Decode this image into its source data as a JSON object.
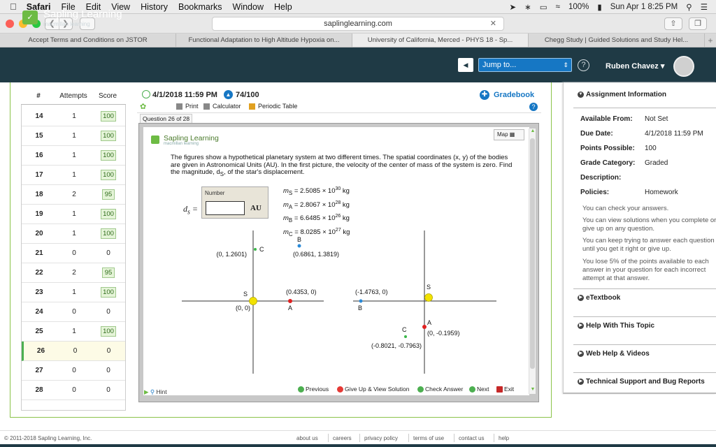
{
  "menubar": {
    "apple": "",
    "items": [
      "Safari",
      "File",
      "Edit",
      "View",
      "History",
      "Bookmarks",
      "Window",
      "Help"
    ],
    "battery": "100%",
    "datetime": "Sun Apr 1  8:25 PM"
  },
  "browser": {
    "url": "saplinglearning.com",
    "tabs": [
      "Accept Terms and Conditions on JSTOR",
      "Functional Adaptation to High Altitude Hypoxia on...",
      "University of California, Merced - PHYS 18 - Sp...",
      "Chegg Study | Guided Solutions and Study Hel..."
    ],
    "new_tab": "+"
  },
  "header": {
    "brand": "Sapling Learning",
    "sub": "macmillan learning",
    "jump": "Jump to...",
    "help": "?",
    "user": "Ruben Chavez ▾"
  },
  "attempts": {
    "headers": [
      "#",
      "Attempts",
      "Score"
    ],
    "rows": [
      {
        "q": "14",
        "a": "1",
        "s": "100",
        "boxed": true
      },
      {
        "q": "15",
        "a": "1",
        "s": "100",
        "boxed": true
      },
      {
        "q": "16",
        "a": "1",
        "s": "100",
        "boxed": true
      },
      {
        "q": "17",
        "a": "1",
        "s": "100",
        "boxed": true
      },
      {
        "q": "18",
        "a": "2",
        "s": "95",
        "boxed": true
      },
      {
        "q": "19",
        "a": "1",
        "s": "100",
        "boxed": true
      },
      {
        "q": "20",
        "a": "1",
        "s": "100",
        "boxed": true
      },
      {
        "q": "21",
        "a": "0",
        "s": "0",
        "boxed": false
      },
      {
        "q": "22",
        "a": "2",
        "s": "95",
        "boxed": true
      },
      {
        "q": "23",
        "a": "1",
        "s": "100",
        "boxed": true
      },
      {
        "q": "24",
        "a": "0",
        "s": "0",
        "boxed": false
      },
      {
        "q": "25",
        "a": "1",
        "s": "100",
        "boxed": true
      },
      {
        "q": "26",
        "a": "0",
        "s": "0",
        "boxed": false,
        "current": true
      },
      {
        "q": "27",
        "a": "0",
        "s": "0",
        "boxed": false
      },
      {
        "q": "28",
        "a": "0",
        "s": "0",
        "boxed": false
      }
    ]
  },
  "question": {
    "due": "4/1/2018 11:59 PM",
    "points": "74/100",
    "gradebook": "Gradebook",
    "tools": [
      "Print",
      "Calculator",
      "Periodic Table"
    ],
    "label": "Question 26 of 28",
    "brand": "Sapling Learning",
    "brand_sub": "macmillan learning",
    "map": "Map",
    "text": "The figures show a hypothetical planetary system at two different times. The spatial coordinates (x, y) of the bodies are given in Astronomical Units (AU). In the first picture, the velocity of the center of mass of the system is zero. Find the magnitude, d",
    "text_sub": "S",
    "text_end": ", of the star's displacement.",
    "answer_label": "Number",
    "answer_value": "",
    "answer_unit": "AU",
    "ds": "d",
    "ds_sub": "s",
    "ds_eq": " =",
    "masses": [
      {
        "sym": "m",
        "sub": "S",
        "val": " = 2.5085 × 10",
        "exp": "30",
        "unit": " kg"
      },
      {
        "sym": "m",
        "sub": "A",
        "val": " = 2.8067 × 10",
        "exp": "28",
        "unit": " kg"
      },
      {
        "sym": "m",
        "sub": "B",
        "val": " = 6.6485 × 10",
        "exp": "26",
        "unit": " kg"
      },
      {
        "sym": "m",
        "sub": "C",
        "val": " = 8.0285 × 10",
        "exp": "27",
        "unit": " kg"
      }
    ],
    "diagram": {
      "left": {
        "C": {
          "label": "C",
          "coord": "(0, 1.2601)"
        },
        "B": {
          "label": "B",
          "coord": "(0.6861, 1.3819)"
        },
        "S": {
          "label": "S",
          "coord": "(0, 0)"
        },
        "A": {
          "label": "A",
          "coord": "(0.4353, 0)"
        }
      },
      "right": {
        "S": {
          "label": "S"
        },
        "B": {
          "label": "B",
          "coord": "(-1.4763, 0)"
        },
        "A": {
          "label": "A",
          "coord": "(0, -0.1959)"
        },
        "C": {
          "label": "C",
          "coord": "(-0.8021, -0.7963)"
        }
      },
      "colors": {
        "star": "#f2e200",
        "A": "#e02020",
        "B": "#2a8ad8",
        "C": "#3ab84a"
      }
    },
    "hint": "Hint",
    "previous": "Previous",
    "giveup": "Give Up & View Solution",
    "check": "Check Answer",
    "next": "Next",
    "exit": "Exit"
  },
  "panel": {
    "assignment_info": "Assignment Information",
    "fields": [
      {
        "k": "Available From:",
        "v": "Not Set"
      },
      {
        "k": "Due Date:",
        "v": "4/1/2018 11:59 PM"
      },
      {
        "k": "Points Possible:",
        "v": "100"
      },
      {
        "k": "Grade Category:",
        "v": "Graded"
      },
      {
        "k": "Description:",
        "v": ""
      },
      {
        "k": "Policies:",
        "v": "Homework"
      }
    ],
    "policies": [
      "You can check your answers.",
      "You can view solutions when you complete or",
      "give up on any question.",
      "You can keep trying to answer each question",
      "until you get it right or give up.",
      "You lose 5% of the points available to each",
      "answer in your question for each incorrect",
      "attempt at that answer."
    ],
    "sections": [
      "eTextbook",
      "Help With This Topic",
      "Web Help & Videos",
      "Technical Support and Bug Reports"
    ]
  },
  "footer": {
    "copyright": "© 2011-2018 Sapling Learning, Inc.",
    "links": [
      "about us",
      "careers",
      "privacy policy",
      "terms of use",
      "contact us",
      "help"
    ]
  }
}
